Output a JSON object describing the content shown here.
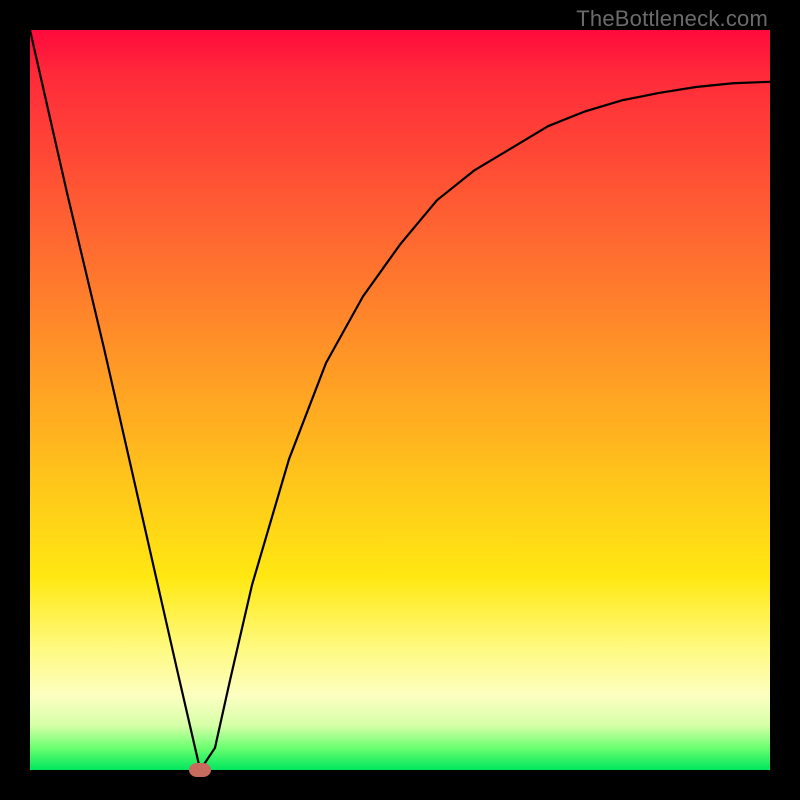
{
  "watermark": "TheBottleneck.com",
  "chart_data": {
    "type": "line",
    "title": "",
    "xlabel": "",
    "ylabel": "",
    "xlim": [
      0,
      100
    ],
    "ylim": [
      0,
      100
    ],
    "grid": false,
    "legend": false,
    "series": [
      {
        "name": "curve",
        "x": [
          0,
          5,
          10,
          15,
          20,
          23,
          25,
          27,
          30,
          35,
          40,
          45,
          50,
          55,
          60,
          65,
          70,
          75,
          80,
          85,
          90,
          95,
          100
        ],
        "y": [
          100,
          78,
          57,
          35,
          13,
          0,
          3,
          12,
          25,
          42,
          55,
          64,
          71,
          77,
          81,
          84,
          87,
          89,
          90.5,
          91.5,
          92.3,
          92.8,
          93
        ]
      }
    ],
    "marker": {
      "x": 23,
      "y": 0,
      "color": "#c66b5d"
    },
    "background_gradient": {
      "direction": "top-to-bottom",
      "stops": [
        {
          "pos": 0,
          "color": "#ff0a3c"
        },
        {
          "pos": 25,
          "color": "#ff5f33"
        },
        {
          "pos": 50,
          "color": "#ffb020"
        },
        {
          "pos": 75,
          "color": "#ffe812"
        },
        {
          "pos": 90,
          "color": "#fcffc1"
        },
        {
          "pos": 100,
          "color": "#00e65e"
        }
      ]
    }
  }
}
